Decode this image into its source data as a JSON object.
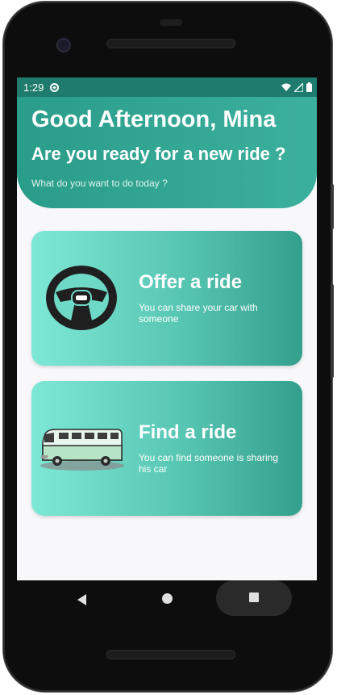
{
  "status_bar": {
    "time": "1:29"
  },
  "header": {
    "greeting": "Good Afternoon, Mina",
    "question": "Are you ready for a new ride ?",
    "subtitle": "What do you want to do today ?"
  },
  "cards": [
    {
      "title": "Offer a ride",
      "description": "You can share your car with someone",
      "icon": "steering-wheel-icon"
    },
    {
      "title": "Find a ride",
      "description": "You can find someone is sharing his car",
      "icon": "van-icon"
    }
  ],
  "colors": {
    "header": "#2a9d8a",
    "status_bar": "#1e7b6d",
    "card_start": "#7ee8d6",
    "card_end": "#33a08d"
  }
}
